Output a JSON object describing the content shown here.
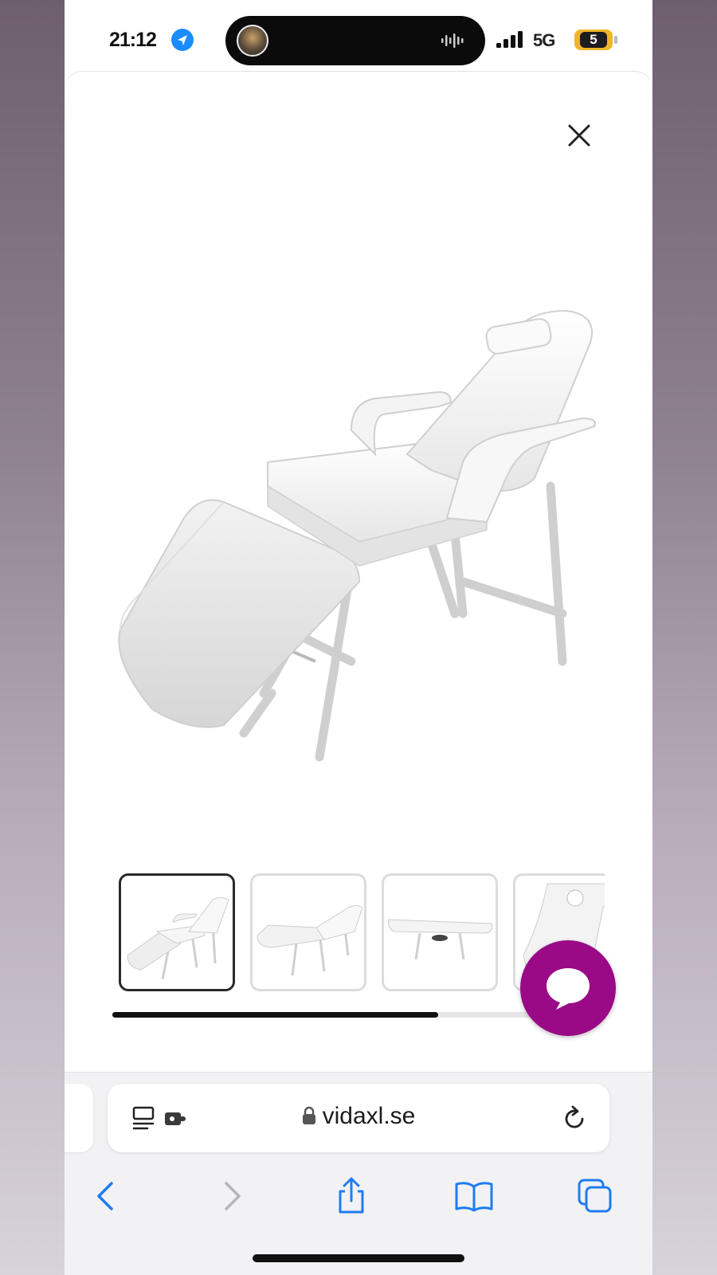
{
  "status_bar": {
    "time": "21:12",
    "network": "5G",
    "battery": "5",
    "icons": [
      "location-icon",
      "signal-icon",
      "battery-icon"
    ]
  },
  "dynamic_island": {
    "icons": [
      "avatar",
      "waveform-icon"
    ]
  },
  "product_viewer": {
    "close_icon": "close-icon",
    "gallery_progress": 0.73,
    "thumbnails": [
      {
        "view": "reclined",
        "active": true
      },
      {
        "view": "flat-side",
        "active": false
      },
      {
        "view": "flat-low",
        "active": false
      },
      {
        "view": "headrest-detail",
        "active": false
      }
    ]
  },
  "chat": {
    "icon": "chat-bubble-icon"
  },
  "browser": {
    "url": "vidaxl.se",
    "address_bar_icons": [
      "reader-icon",
      "extension-icon",
      "lock-icon",
      "reload-icon"
    ],
    "toolbar": [
      "back-icon",
      "forward-icon",
      "share-icon",
      "bookmarks-icon",
      "tabs-icon"
    ]
  },
  "colors": {
    "accent": "#1f7cf2",
    "chat_button": "#9a0a86",
    "battery": "#f0b528",
    "background_top": "#6e5f6c",
    "background_bottom": "#d8d2da"
  }
}
